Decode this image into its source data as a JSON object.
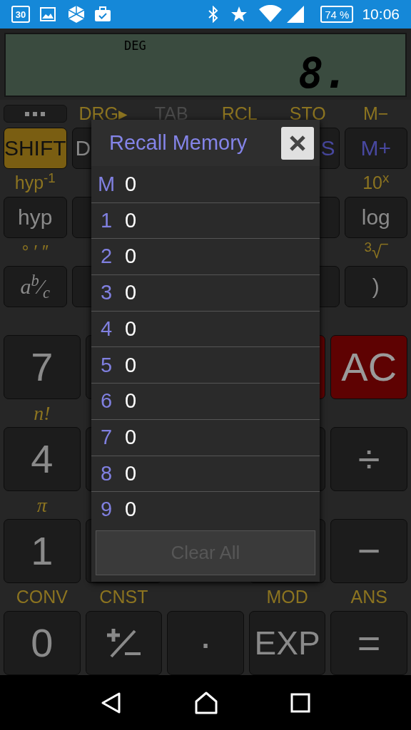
{
  "status_bar": {
    "calendar_day": "30",
    "battery": "74 %",
    "time": "10:06"
  },
  "display": {
    "mode": "DEG",
    "value": "8."
  },
  "rows": [
    {
      "kind": "small_labels",
      "left": [
        {
          "kind": "menu"
        },
        {
          "text": "DRG▸",
          "disabled": false
        },
        {
          "text": "TAB",
          "disabled": true
        },
        {
          "text": "RCL",
          "disabled": false
        },
        {
          "text": "STO",
          "disabled": false
        },
        {
          "text": "M−",
          "disabled": false
        }
      ]
    },
    {
      "kind": "small_keys",
      "left": [
        {
          "label": "SHIFT",
          "kind": "shift"
        },
        {
          "label": "D",
          "kind": "plain"
        }
      ],
      "right": [
        {
          "label": "S",
          "kind": "memory"
        },
        {
          "label": "M+",
          "kind": "memory"
        }
      ]
    },
    {
      "kind": "small_labels",
      "left": [
        {
          "text": "hyp$^{-1}$",
          "disabled": false
        }
      ],
      "right": [
        {
          "text": "10$^{x}$",
          "disabled": false
        }
      ]
    },
    {
      "kind": "small_keys",
      "left": [
        {
          "label": "hyp",
          "kind": "plain"
        },
        {
          "kind": "plain"
        }
      ],
      "right": [
        {
          "kind": "plain"
        },
        {
          "label": "log",
          "kind": "plain"
        }
      ]
    },
    {
      "kind": "small_labels",
      "left": [
        {
          "text": "° ′ ″",
          "disabled": false
        }
      ],
      "right": [
        {
          "text": "$^{3}$√‾",
          "disabled": false
        }
      ]
    },
    {
      "kind": "small_keys",
      "left": [
        {
          "label": "a$^{b}$⁄$_{c}$",
          "kind": "serif"
        },
        {
          "kind": "plain"
        }
      ],
      "right": [
        {
          "kind": "plain"
        },
        {
          "label": ")",
          "kind": "plain"
        }
      ]
    },
    {
      "kind": "large_keys",
      "left": [
        {
          "label": "7",
          "kind": "plain"
        },
        {
          "kind": "plain"
        }
      ],
      "right": [
        {
          "kind": "red"
        },
        {
          "label": "AC",
          "kind": "red"
        }
      ]
    },
    {
      "kind": "large_labels",
      "left": [
        {
          "text": "n!",
          "disabled": false,
          "kind": "serif"
        }
      ]
    },
    {
      "kind": "large_keys",
      "left": [
        {
          "label": "4",
          "kind": "plain"
        },
        {
          "kind": "plain"
        }
      ],
      "right": [
        {
          "kind": "plain"
        },
        {
          "label": "÷",
          "kind": "plain"
        }
      ]
    },
    {
      "kind": "large_labels",
      "left": [
        {
          "text": "π",
          "disabled": false,
          "kind": "serif"
        }
      ]
    },
    {
      "kind": "large_keys",
      "left": [
        {
          "label": "1",
          "kind": "plain"
        },
        {
          "kind": "plain"
        }
      ],
      "right": [
        {
          "kind": "plain"
        },
        {
          "label": "−",
          "kind": "plain"
        }
      ]
    },
    {
      "kind": "large_labels",
      "left": [
        {
          "text": "CONV",
          "disabled": false
        },
        {
          "text": "CNST",
          "disabled": false
        }
      ],
      "right": [
        {
          "text": "MOD",
          "disabled": false
        },
        {
          "text": "ANS",
          "disabled": false
        }
      ]
    },
    {
      "kind": "large_keys",
      "left": [
        {
          "label": "0",
          "kind": "plain"
        },
        {
          "kind": "plus_minus"
        },
        {
          "label": "·",
          "kind": "plain"
        },
        {
          "label": "EXP",
          "kind": "plain"
        },
        {
          "label": "=",
          "kind": "plain"
        }
      ]
    }
  ],
  "dialog": {
    "title": "Recall Memory",
    "memories": [
      {
        "slot": "M",
        "value": "0"
      },
      {
        "slot": "1",
        "value": "0"
      },
      {
        "slot": "2",
        "value": "0"
      },
      {
        "slot": "3",
        "value": "0"
      },
      {
        "slot": "4",
        "value": "0"
      },
      {
        "slot": "5",
        "value": "0"
      },
      {
        "slot": "6",
        "value": "0"
      },
      {
        "slot": "7",
        "value": "0"
      },
      {
        "slot": "8",
        "value": "0"
      },
      {
        "slot": "9",
        "value": "0"
      }
    ],
    "clear_button": {
      "label": "Clear All",
      "disabled": true
    }
  }
}
